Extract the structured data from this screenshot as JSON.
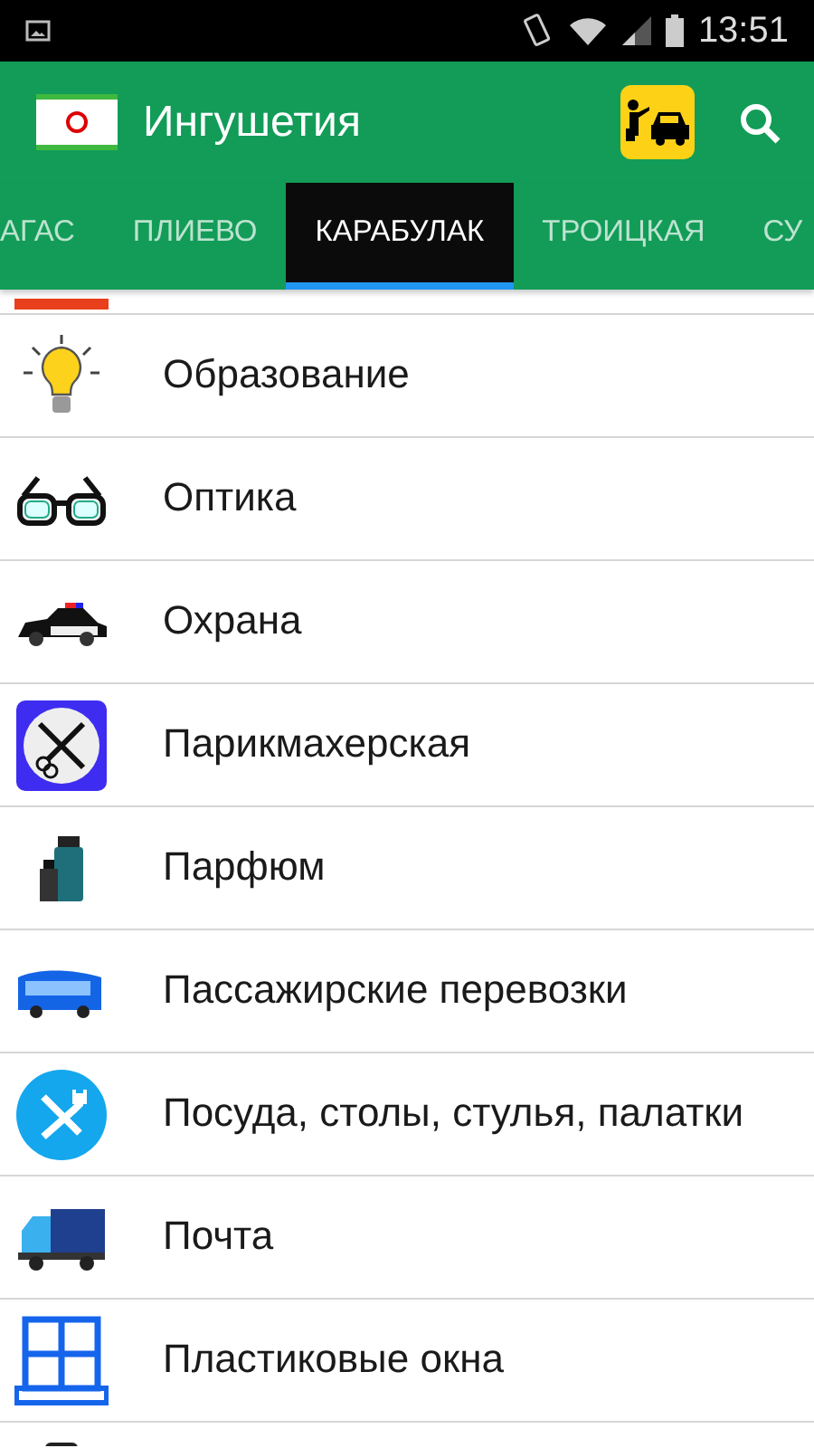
{
  "status_bar": {
    "time": "13:51"
  },
  "app_bar": {
    "title": "Ингушетия"
  },
  "tabs": [
    {
      "label": "АГАС",
      "selected": false
    },
    {
      "label": "ПЛИЕВО",
      "selected": false
    },
    {
      "label": "КАРАБУЛАК",
      "selected": true
    },
    {
      "label": "ТРОИЦКАЯ",
      "selected": false
    },
    {
      "label": "СУ",
      "selected": false
    }
  ],
  "items": [
    {
      "label": "Образование",
      "kind": "bulb"
    },
    {
      "label": "Оптика",
      "kind": "glasses"
    },
    {
      "label": "Охрана",
      "kind": "police"
    },
    {
      "label": "Парикмахерская",
      "kind": "scissors"
    },
    {
      "label": "Парфюм",
      "kind": "perfume"
    },
    {
      "label": "Пассажирские перевозки",
      "kind": "bus"
    },
    {
      "label": "Посуда, столы, стулья, палатки",
      "kind": "cutlery"
    },
    {
      "label": "Почта",
      "kind": "truck"
    },
    {
      "label": "Пластиковые окна",
      "kind": "window"
    }
  ]
}
